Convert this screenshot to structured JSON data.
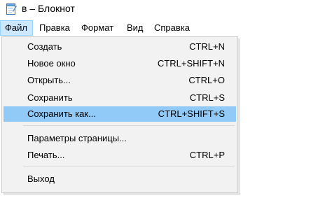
{
  "window": {
    "title": "в – Блокнот",
    "icon": "notepad-icon"
  },
  "menubar": {
    "items": [
      {
        "label": "Файл",
        "active": true
      },
      {
        "label": "Правка",
        "active": false
      },
      {
        "label": "Формат",
        "active": false
      },
      {
        "label": "Вид",
        "active": false
      },
      {
        "label": "Справка",
        "active": false
      }
    ]
  },
  "file_menu": {
    "highlighted_index": 4,
    "items": [
      {
        "label": "Создать",
        "shortcut": "CTRL+N"
      },
      {
        "label": "Новое окно",
        "shortcut": "CTRL+SHIFT+N"
      },
      {
        "label": "Открыть...",
        "shortcut": "CTRL+O"
      },
      {
        "label": "Сохранить",
        "shortcut": "CTRL+S"
      },
      {
        "label": "Сохранить как...",
        "shortcut": "CTRL+SHIFT+S"
      },
      {
        "label": "Параметры страницы...",
        "shortcut": ""
      },
      {
        "label": "Печать...",
        "shortcut": "CTRL+P"
      },
      {
        "label": "Выход",
        "shortcut": ""
      }
    ]
  },
  "colors": {
    "menu_active_bg": "#cce8ff",
    "menu_active_border": "#99d1ff",
    "dropdown_bg": "#f2f2f2",
    "highlight_bg": "#91c9f7"
  }
}
